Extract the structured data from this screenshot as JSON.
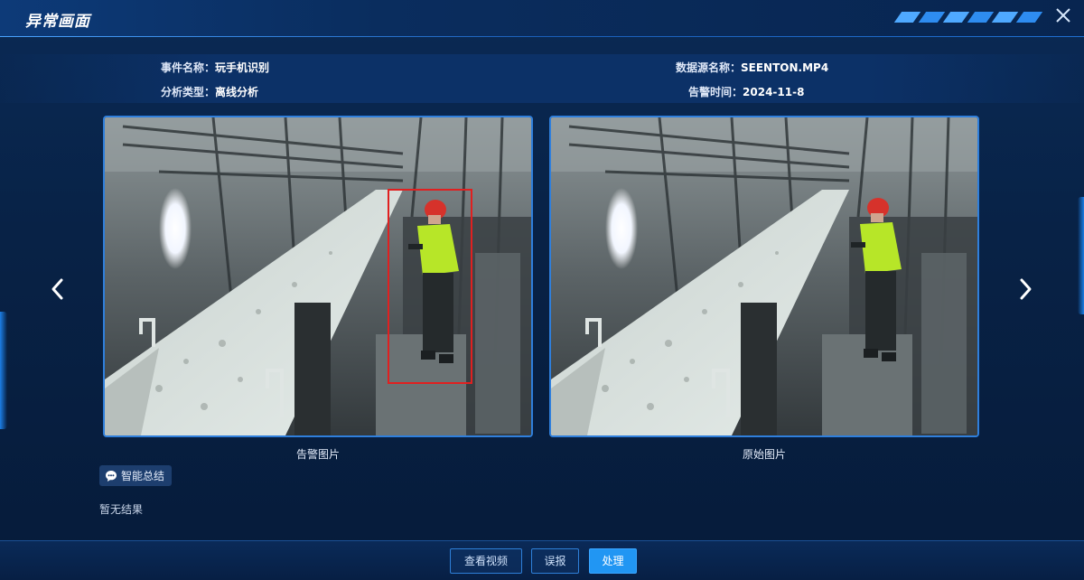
{
  "dialog": {
    "title": "异常画面"
  },
  "info": {
    "event_name_label": "事件名称：",
    "event_name_value": "玩手机识别",
    "analysis_type_label": "分析类型：",
    "analysis_type_value": "离线分析",
    "source_name_label": "数据源名称：",
    "source_name_value": "SEENTON.MP4",
    "alarm_time_label": "告警时间：",
    "alarm_time_value": "2024-11-8"
  },
  "images": {
    "alarm_caption": "告警图片",
    "original_caption": "原始图片"
  },
  "ai": {
    "badge_label": "智能总结",
    "result_text": "暂无结果"
  },
  "footer": {
    "view_video_label": "查看视频",
    "false_alarm_label": "误报",
    "handle_label": "处理"
  },
  "colors": {
    "accent": "#2196f3",
    "detection_box": "#e02020",
    "frame_border": "#2f7fdc"
  },
  "icons": [
    "close-icon",
    "chevron-left-icon",
    "chevron-right-icon",
    "ai-chat-icon"
  ]
}
